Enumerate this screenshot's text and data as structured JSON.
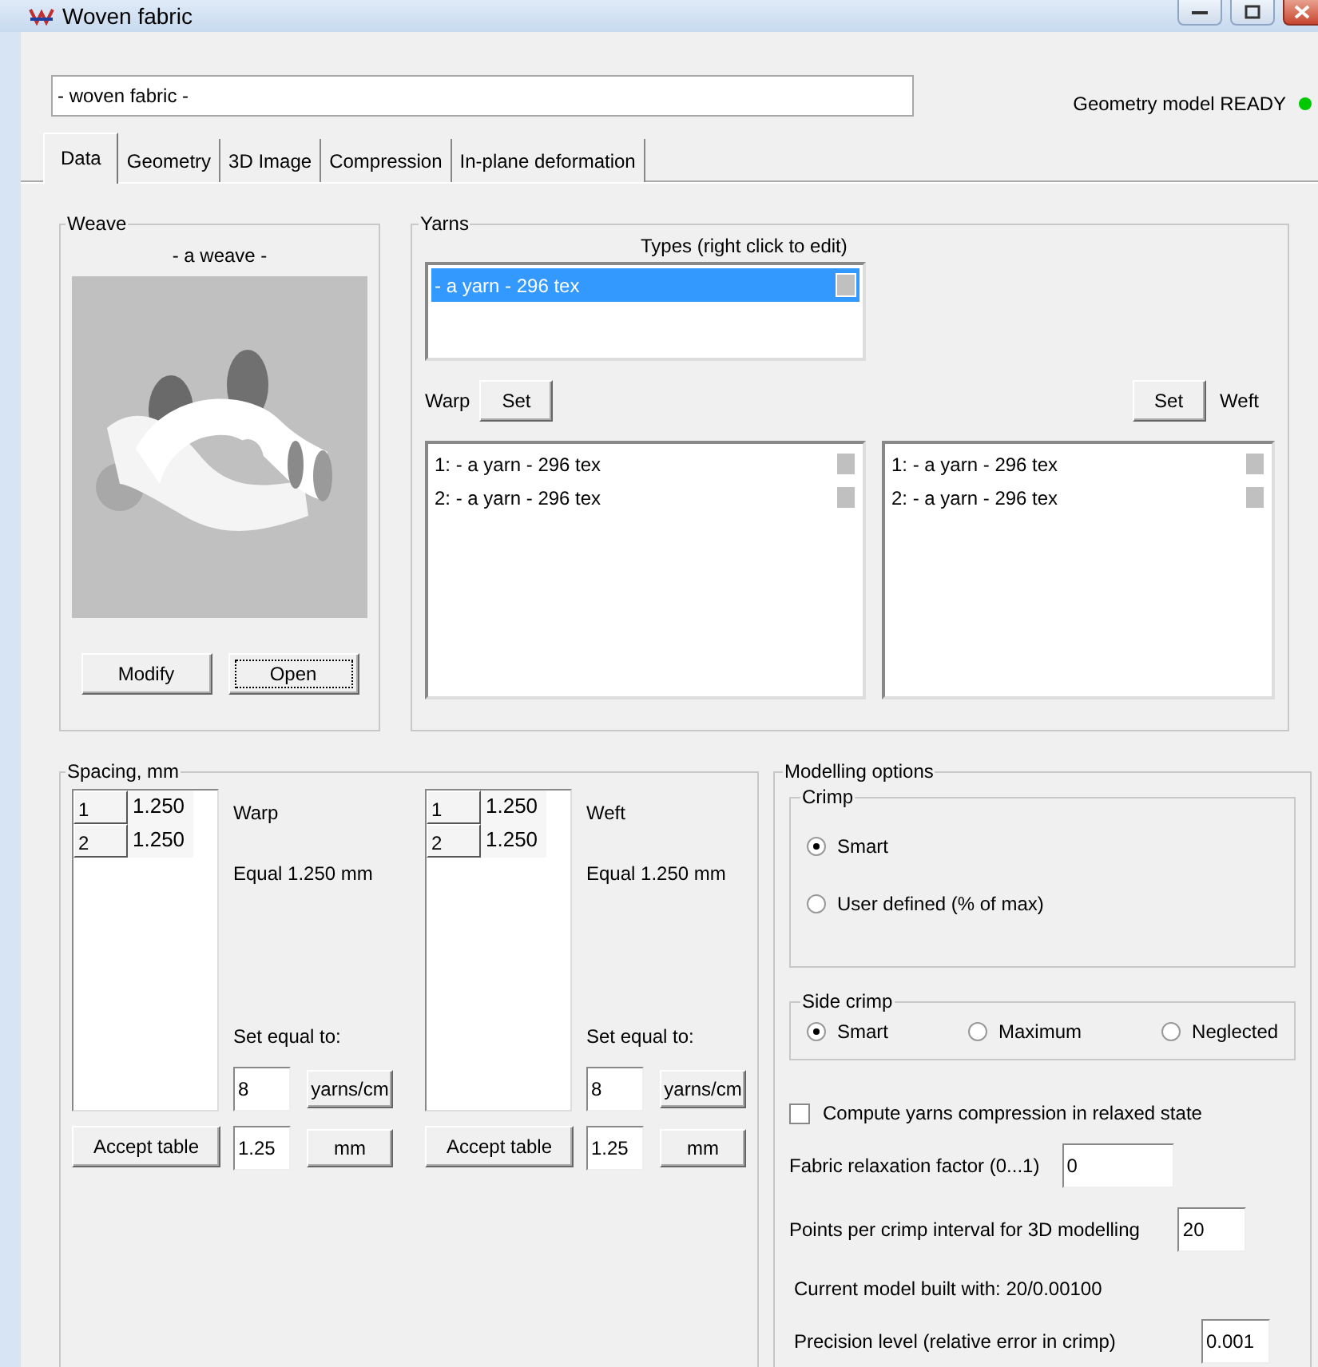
{
  "window": {
    "title": "Woven fabric"
  },
  "name_field": {
    "value": "- woven fabric -"
  },
  "status": {
    "label": "Geometry model READY",
    "color": "#00c800"
  },
  "tabs": [
    {
      "label": "Data",
      "selected": true
    },
    {
      "label": "Geometry",
      "selected": false
    },
    {
      "label": "3D Image",
      "selected": false
    },
    {
      "label": "Compression",
      "selected": false
    },
    {
      "label": "In-plane deformation",
      "selected": false
    }
  ],
  "weave": {
    "title": "Weave",
    "name": "- a weave -",
    "buttons": [
      {
        "label": "Modify",
        "focused": false
      },
      {
        "label": "Open",
        "focused": true
      }
    ]
  },
  "yarns": {
    "title": "Yarns",
    "types_label": "Types (right click to edit)",
    "types": [
      {
        "label": "- a yarn - 296 tex",
        "color": "#c0c0c0",
        "selected": true
      }
    ],
    "warp": {
      "label": "Warp",
      "button": "Set",
      "items": [
        {
          "label": "1: - a yarn - 296 tex",
          "color": "#c0c0c0"
        },
        {
          "label": "2: - a yarn - 296 tex",
          "color": "#c0c0c0"
        }
      ]
    },
    "weft": {
      "label": "Weft",
      "button": "Set",
      "items": [
        {
          "label": "1: - a yarn - 296 tex",
          "color": "#c0c0c0"
        },
        {
          "label": "2: - a yarn - 296 tex",
          "color": "#c0c0c0"
        }
      ]
    }
  },
  "spacing": {
    "title": "Spacing, mm",
    "sides": [
      {
        "label": "Warp",
        "rows": [
          {
            "index": "1",
            "value": "1.250"
          },
          {
            "index": "2",
            "value": "1.250"
          }
        ],
        "equal": "Equal 1.250 mm",
        "set_equal_label": "Set equal to:",
        "density": "8",
        "density_unit": "yarns/cm",
        "spacing": "1.25",
        "spacing_unit": "mm",
        "accept": "Accept table"
      },
      {
        "label": "Weft",
        "rows": [
          {
            "index": "1",
            "value": "1.250"
          },
          {
            "index": "2",
            "value": "1.250"
          }
        ],
        "equal": "Equal 1.250 mm",
        "set_equal_label": "Set equal to:",
        "density": "8",
        "density_unit": "yarns/cm",
        "spacing": "1.25",
        "spacing_unit": "mm",
        "accept": "Accept table"
      }
    ]
  },
  "modelling": {
    "title": "Modelling options",
    "crimp": {
      "title": "Crimp",
      "options": [
        {
          "label": "Smart",
          "selected": true
        },
        {
          "label": "User defined (% of max)",
          "selected": false
        }
      ]
    },
    "side_crimp": {
      "title": "Side crimp",
      "options": [
        {
          "label": "Smart",
          "selected": true
        },
        {
          "label": "Maximum",
          "selected": false
        },
        {
          "label": "Neglected",
          "selected": false
        }
      ]
    },
    "compression": {
      "label": "Compute yarns compression in relaxed state",
      "checked": false
    },
    "relaxation": {
      "label": "Fabric relaxation factor (0...1)",
      "value": "0"
    },
    "points": {
      "label": "Points per crimp interval for 3D modelling",
      "value": "20"
    },
    "current_model": "Current model built with: 20/0.00100",
    "precision": {
      "label": "Precision level (relative error in crimp)",
      "value": "0.001"
    }
  }
}
